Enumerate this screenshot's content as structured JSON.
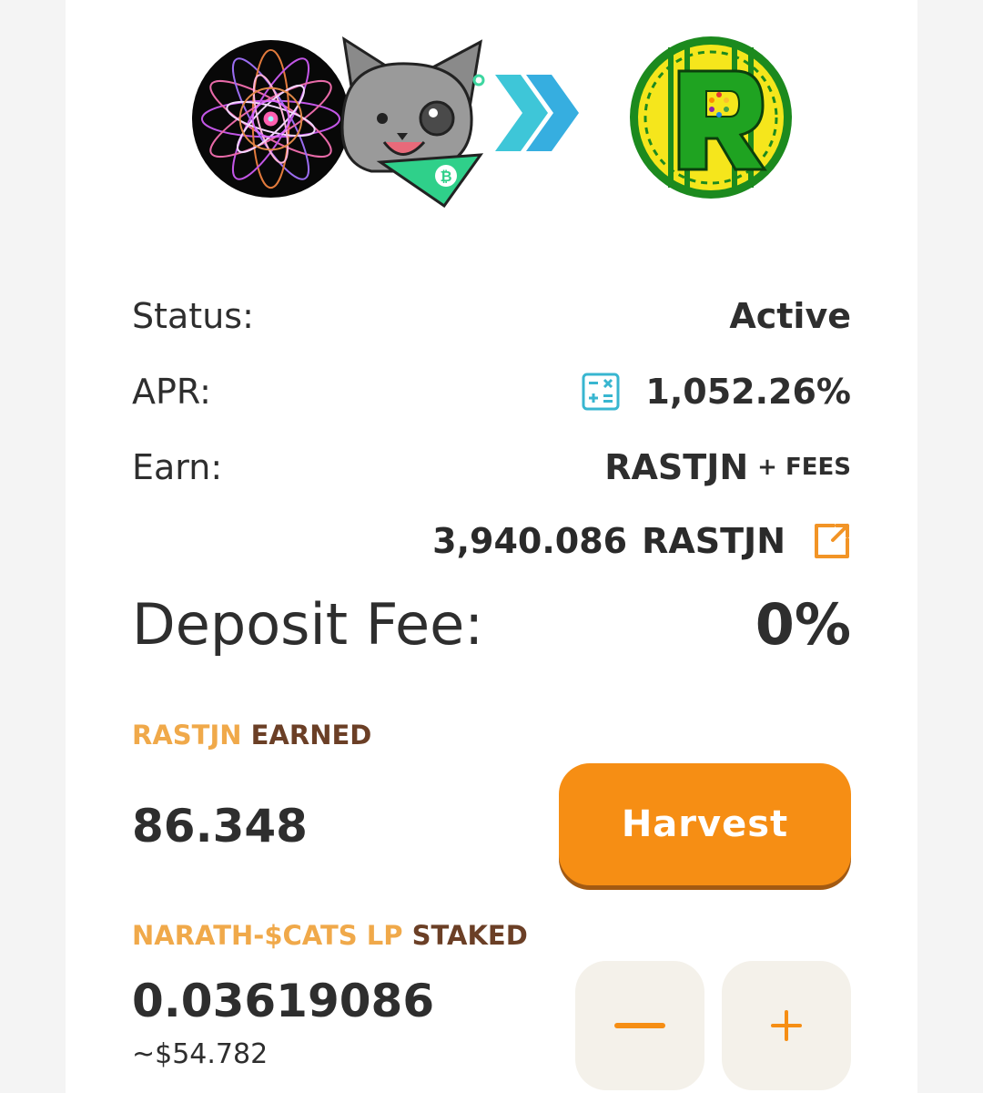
{
  "status": {
    "label": "Status:",
    "value": "Active"
  },
  "apr": {
    "label": "APR:",
    "value": "1,052.26%"
  },
  "earn": {
    "label": "Earn:",
    "token": "RASTJN",
    "fees": "+ FEES"
  },
  "total_staked": {
    "amount": "3,940.086",
    "unit": "RASTJN"
  },
  "deposit_fee": {
    "label": "Deposit Fee:",
    "value": "0%"
  },
  "earned": {
    "token": "RASTJN",
    "suffix": "EARNED",
    "value": "86.348"
  },
  "harvest_button": "Harvest",
  "staked": {
    "token": "NARATH-$CATS LP",
    "suffix": "STAKED",
    "value": "0.03619086",
    "usd": "~$54.782"
  },
  "colors": {
    "accent": "#f0a94a",
    "label_brown": "#6b3f26",
    "button_orange": "#f68e14",
    "arrow_teal": "#3ec6d8"
  },
  "icons": {
    "stake_token": "mandala-token-icon",
    "stake_token_2": "cat-token-icon",
    "arrow": "double-chevron-right-icon",
    "reward_token": "rastjn-coin-icon",
    "apr_calculator": "calculator-icon",
    "external_link": "external-link-icon",
    "minus": "minus-icon",
    "plus": "plus-icon"
  }
}
